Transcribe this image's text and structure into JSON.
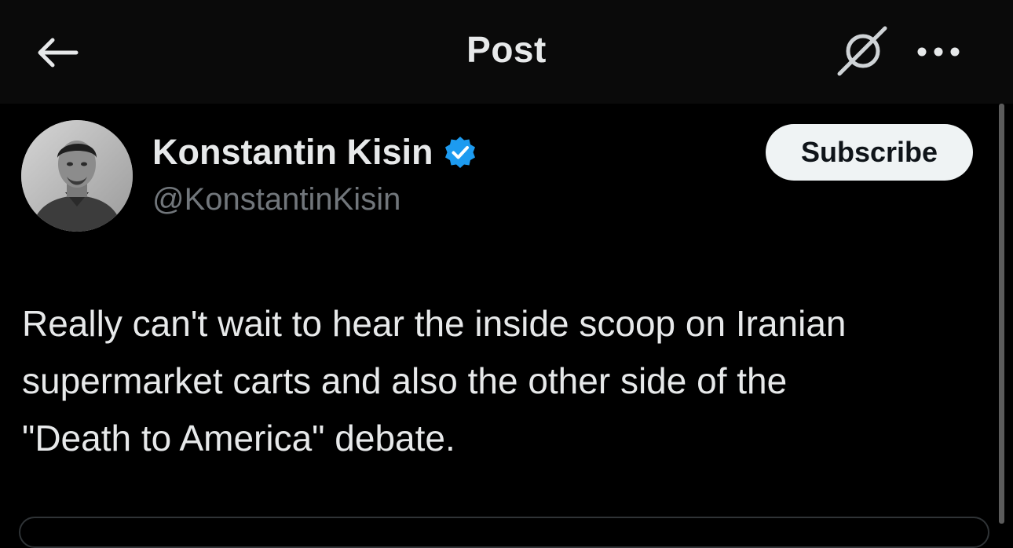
{
  "header": {
    "title": "Post",
    "back_icon": "arrow-left-icon",
    "grok_icon": "grok-icon",
    "more_icon": "more-dots-icon"
  },
  "post": {
    "author": {
      "name": "Konstantin Kisin",
      "handle": "@KonstantinKisin",
      "verified": true,
      "verified_color": "#1d9bf0"
    },
    "subscribe_label": "Subscribe",
    "text": "Really can't wait to hear the inside scoop on Iranian\nsupermarket carts and also the other side of the\n\"Death to America\" debate."
  },
  "colors": {
    "background": "#000000",
    "header_background": "#0a0a0a",
    "primary_text": "#e7e9ea",
    "secondary_text": "#71767b",
    "button_background": "#eff3f4",
    "button_text": "#0f1419"
  }
}
